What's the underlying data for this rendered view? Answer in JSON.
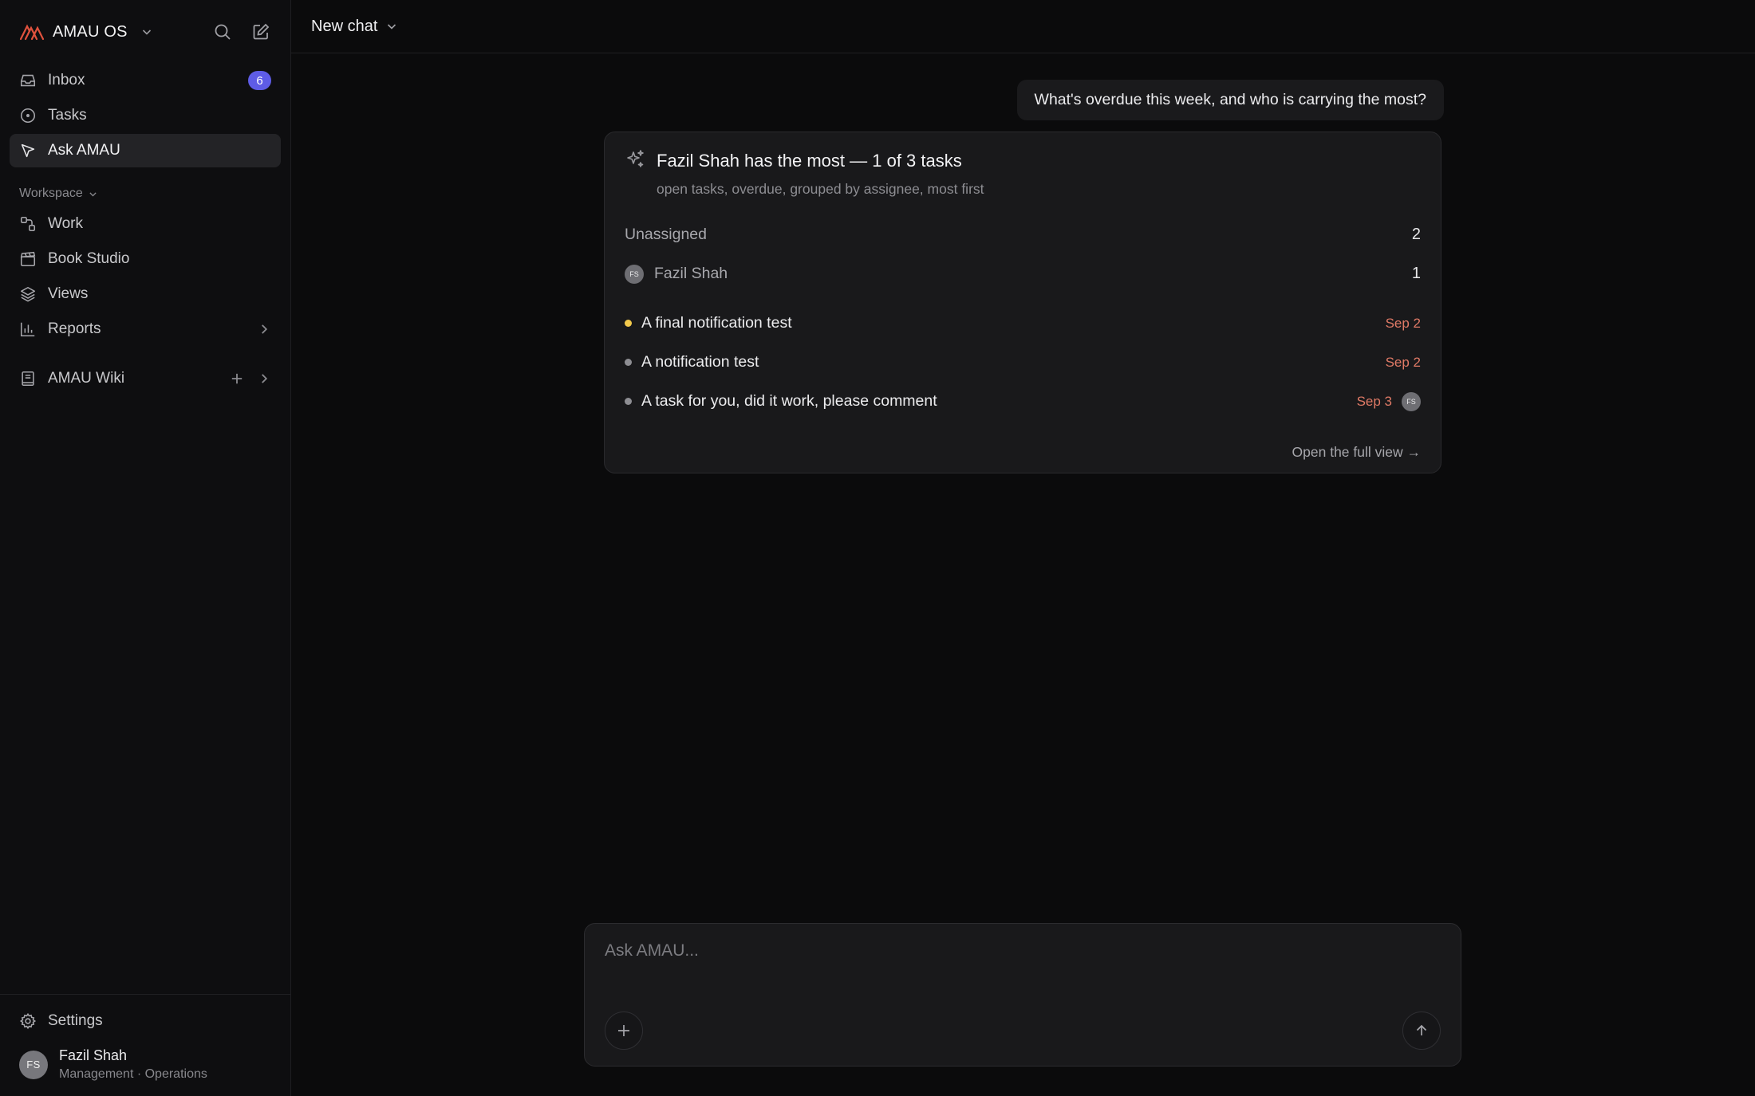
{
  "brand": {
    "name": "AMAU OS",
    "accent": "#e0523e"
  },
  "nav": {
    "inbox": {
      "label": "Inbox",
      "badge": "6",
      "icon": "inbox-icon"
    },
    "tasks": {
      "label": "Tasks",
      "icon": "circle-dot-icon"
    },
    "ask": {
      "label": "Ask AMAU",
      "icon": "cursor-arrow-icon",
      "active": true
    }
  },
  "workspace": {
    "label": "Workspace",
    "items": [
      {
        "label": "Work",
        "icon": "workflow-icon"
      },
      {
        "label": "Book Studio",
        "icon": "clapperboard-icon"
      },
      {
        "label": "Views",
        "icon": "layers-icon"
      },
      {
        "label": "Reports",
        "icon": "bar-chart-icon"
      }
    ]
  },
  "wiki": {
    "label": "AMAU Wiki",
    "icon": "book-icon"
  },
  "footer": {
    "settings": "Settings",
    "user": {
      "initials": "FS",
      "name": "Fazil Shah",
      "subtitle": "Management · Operations"
    }
  },
  "topbar": {
    "title": "New chat"
  },
  "conversation": {
    "user_message": "What's overdue this week, and who is carrying the most?",
    "answer": {
      "title": "Fazil Shah has the most — 1 of 3 tasks",
      "subtitle": "open tasks, overdue, grouped by assignee, most first",
      "groups": [
        {
          "name": "Unassigned",
          "count": "2"
        },
        {
          "name": "Fazil Shah",
          "initials": "FS",
          "count": "1"
        }
      ],
      "tasks": [
        {
          "title": "A final notification test",
          "due": "Sep 2",
          "dot_color": "#f2c94c"
        },
        {
          "title": "A notification test",
          "due": "Sep 2",
          "dot_color": "#8e8e93"
        },
        {
          "title": "A task for you, did it work, please comment",
          "due": "Sep 3",
          "dot_color": "#8e8e93",
          "assignee": "FS"
        }
      ],
      "link": "Open the full view →"
    }
  },
  "composer": {
    "placeholder": "Ask AMAU..."
  }
}
